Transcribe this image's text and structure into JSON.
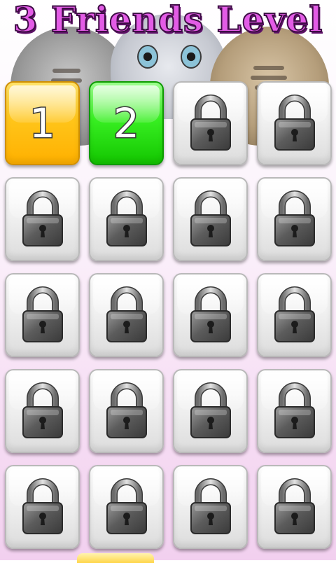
{
  "screen": {
    "title": "3 Friends Level"
  },
  "levels": [
    {
      "label": "1",
      "state": "unlocked",
      "color": "#ffc51a"
    },
    {
      "label": "2",
      "state": "unlocked",
      "color": "#38ef22"
    },
    {
      "label": "",
      "state": "locked"
    },
    {
      "label": "",
      "state": "locked"
    },
    {
      "label": "",
      "state": "locked"
    },
    {
      "label": "",
      "state": "locked"
    },
    {
      "label": "",
      "state": "locked"
    },
    {
      "label": "",
      "state": "locked"
    },
    {
      "label": "",
      "state": "locked"
    },
    {
      "label": "",
      "state": "locked"
    },
    {
      "label": "",
      "state": "locked"
    },
    {
      "label": "",
      "state": "locked"
    },
    {
      "label": "",
      "state": "locked"
    },
    {
      "label": "",
      "state": "locked"
    },
    {
      "label": "",
      "state": "locked"
    },
    {
      "label": "",
      "state": "locked"
    },
    {
      "label": "",
      "state": "locked"
    },
    {
      "label": "",
      "state": "locked"
    },
    {
      "label": "",
      "state": "locked"
    },
    {
      "label": "",
      "state": "locked"
    }
  ],
  "icons": {
    "locked": "padlock-icon"
  },
  "colors": {
    "title": "#e35ce6",
    "title_outline": "#3d0d44",
    "background_bottom": "#f2d0ef"
  }
}
